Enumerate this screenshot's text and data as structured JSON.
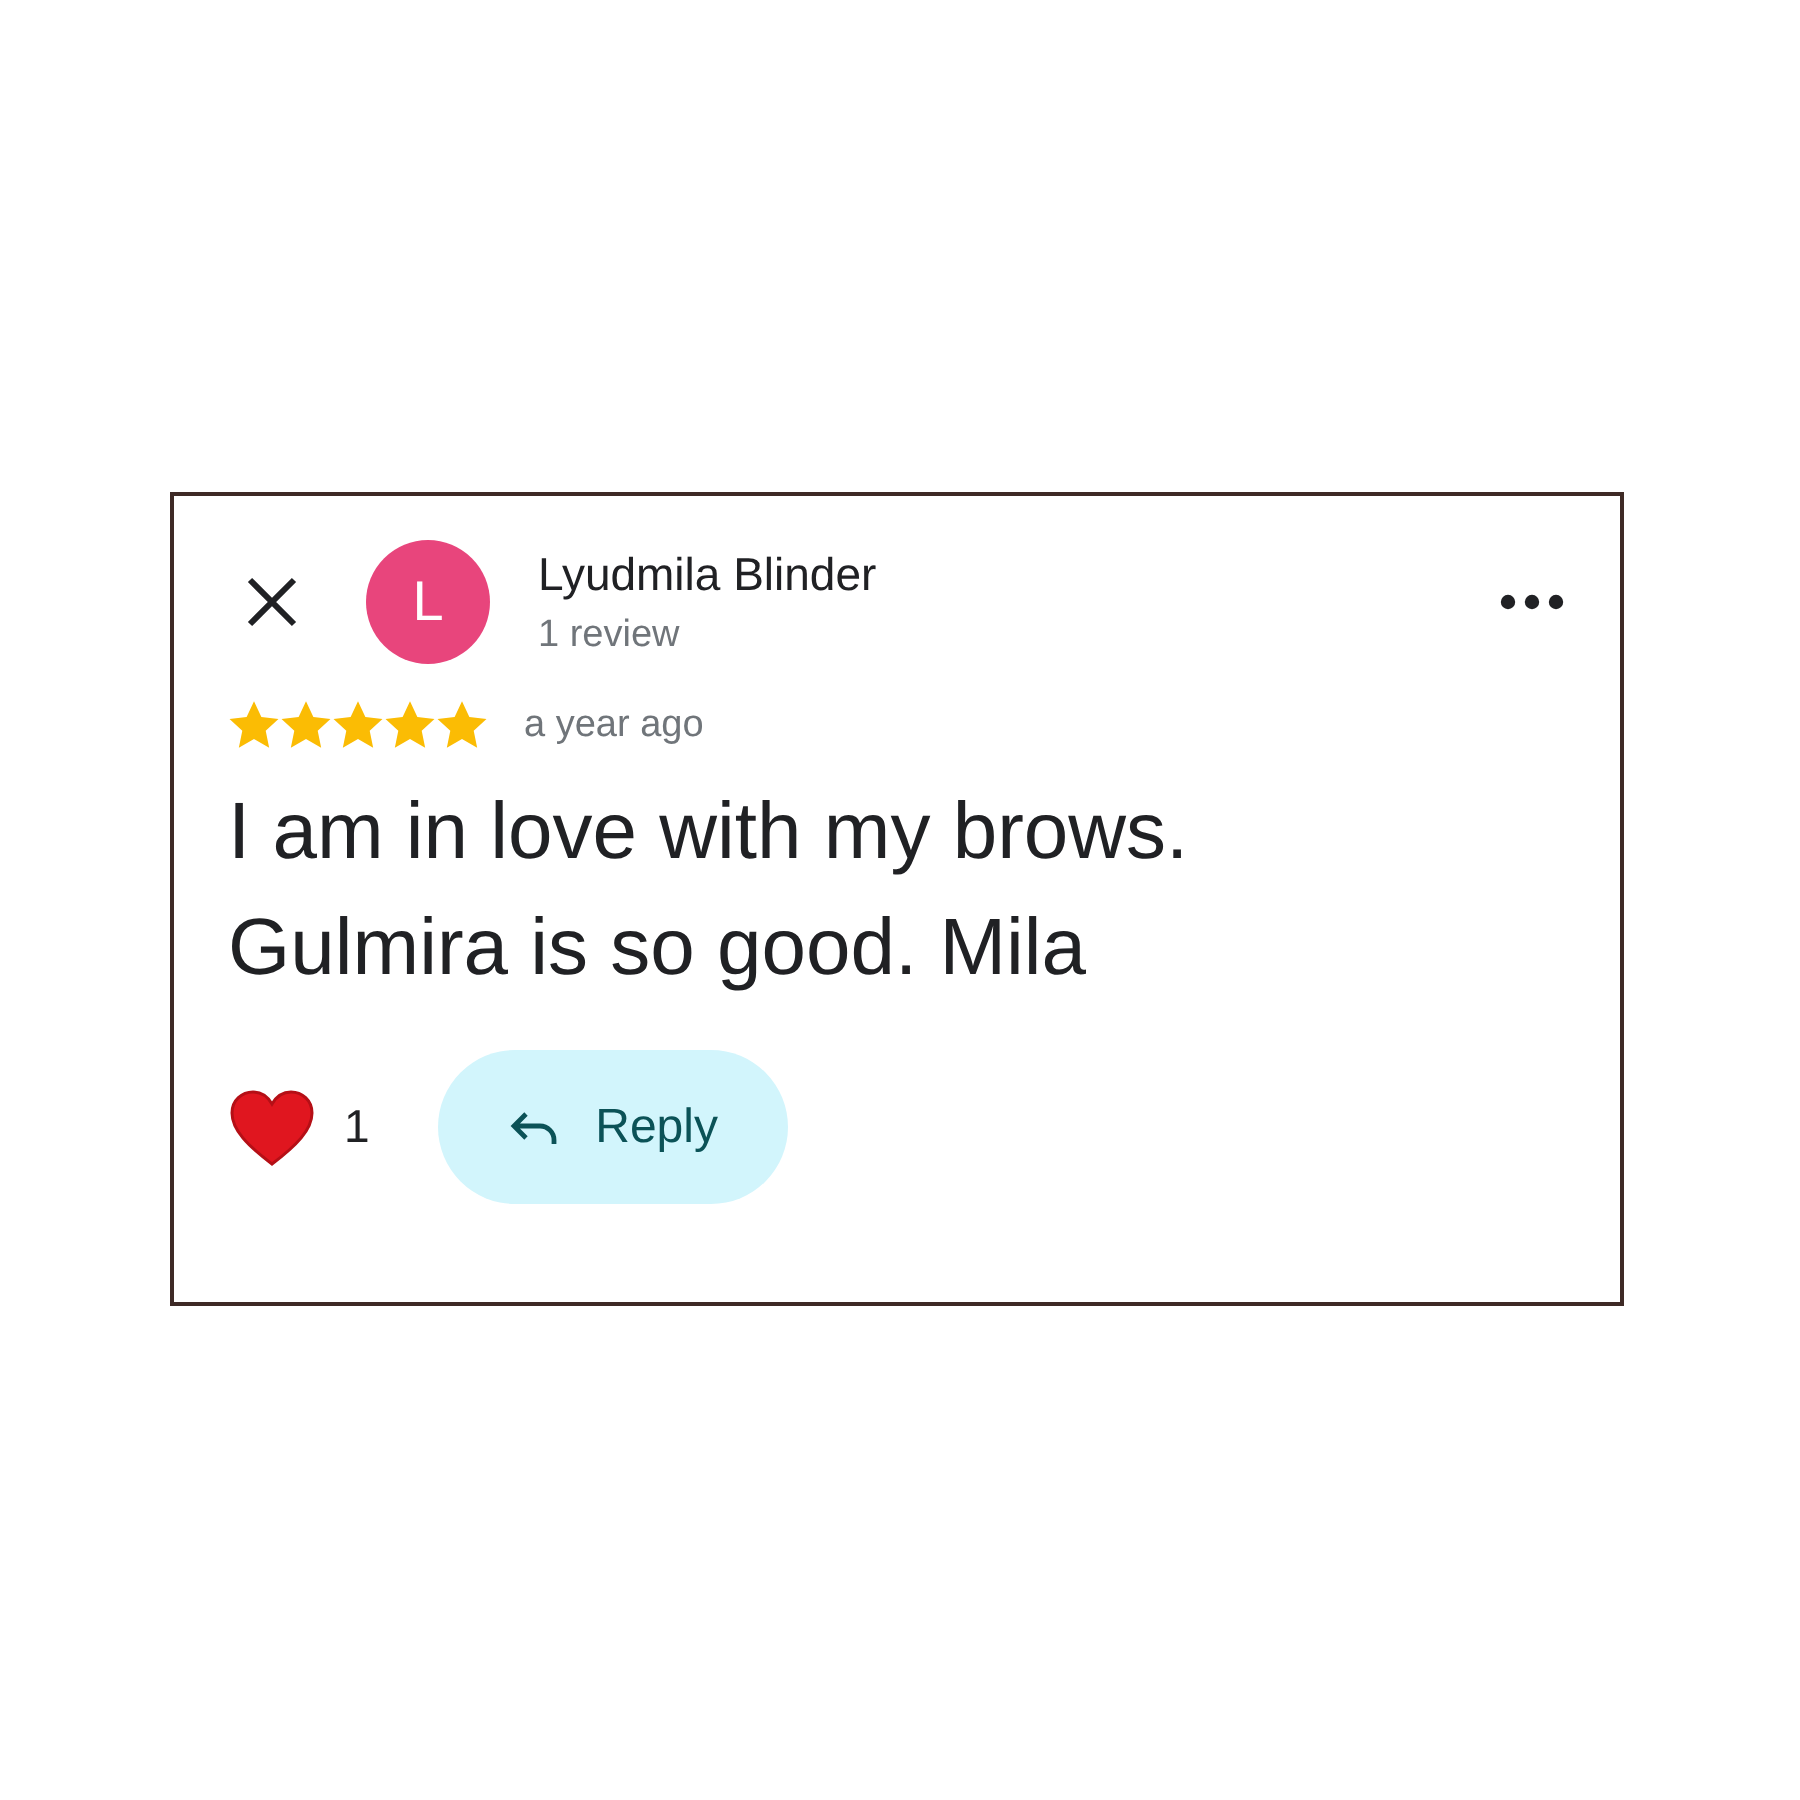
{
  "review": {
    "author": "Lyudmila Blinder",
    "initial": "L",
    "meta": "1 review",
    "stars": 5,
    "time": "a year ago",
    "text": "I am in love with my brows. Gulmira is so good. Mila",
    "likes": "1",
    "liked": true,
    "reply_label": "Reply"
  }
}
